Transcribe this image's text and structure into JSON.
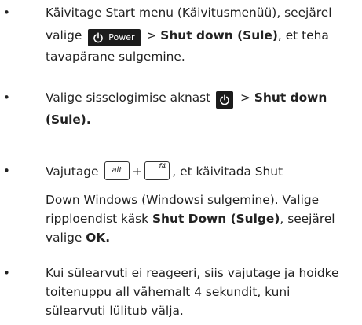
{
  "bullet_char": "•",
  "items": [
    {
      "line1_text": "Käivitage Start menu (Käivitusmenüü), seejärel",
      "line2_pre": "valige",
      "power_label": "Power",
      "line2_sep": ">",
      "line2_bold": "Shut down (Sule)",
      "line2_post": ", et teha",
      "line3_text": "tavapärane sulgemine."
    },
    {
      "line1_pre": "Valige sisselogimise aknast",
      "line1_sep": ">",
      "line1_bold": "Shut down",
      "line2_bold": "(Sule)."
    },
    {
      "line1_pre": "Vajutage",
      "key_alt": "alt",
      "plus": "+",
      "key_f4": "f4",
      "line1_post": ", et käivitada Shut",
      "line2_text": "Down Windows (Windowsi sulgemine). Valige",
      "line3_pre": "ripploendist käsk",
      "line3_bold": "Shut Down (Sulge)",
      "line3_post": ", seejärel",
      "line4_pre": "valige",
      "line4_bold": "OK."
    },
    {
      "line1_text": "Kui sülearvuti ei reageeri, siis vajutage ja hoidke",
      "line2_text": "toitenuppu all vähemalt 4 sekundit, kuni",
      "line3_text": "sülearvuti lülitub välja."
    }
  ],
  "icons": {
    "power": "power-icon"
  }
}
